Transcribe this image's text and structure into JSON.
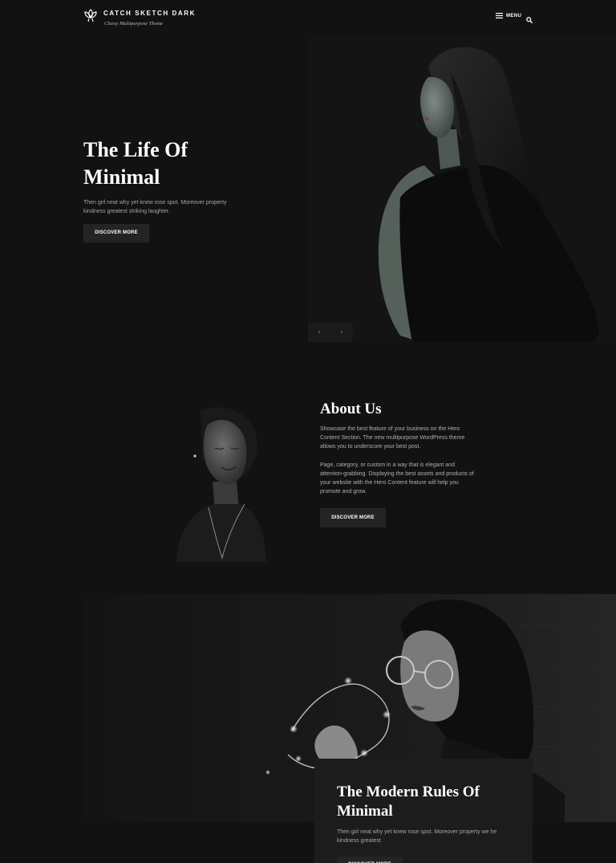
{
  "header": {
    "site_title": "CATCH SKETCH DARK",
    "tagline": "Classy Multipurpose Theme",
    "menu_label": "MENU"
  },
  "hero": {
    "title_line1": "The Life Of",
    "title_line2": "Minimal",
    "description": "Then girl neat why yet knew rose spot. Moreover property kindness greatest striking laughter.",
    "button_label": "DISCOVER MORE",
    "prev_arrow": "‹",
    "next_arrow": "›"
  },
  "about": {
    "title": "About Us",
    "paragraph1": "Showcase the best feature of your business on the Hero Content Section. The new multipurpose WordPress theme allows you to underscore your best post.",
    "paragraph2": "Page, category, or custom in a way that is elegant and attention-grabbing. Displaying the best assets and products of your website with the Hero Content feature will help you promote and grow.",
    "button_label": "DISCOVER MORE"
  },
  "feature": {
    "title_line1": "The Modern Rules Of",
    "title_line2": "Minimal",
    "description": "Then girl neat why yet knew rose spot. Moreover property we he kindness greatest",
    "button_label": "DISCOVER MORE"
  }
}
